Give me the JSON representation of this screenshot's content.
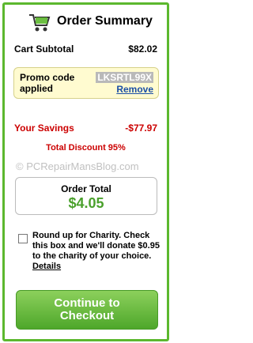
{
  "header": {
    "title": "Order Summary",
    "icon": "cart-icon"
  },
  "subtotal": {
    "label": "Cart Subtotal",
    "value": "$82.02"
  },
  "promo": {
    "label": "Promo code applied",
    "code": "LKSRTL99X",
    "remove_label": "Remove"
  },
  "savings": {
    "label": "Your Savings",
    "value": "-$77.97"
  },
  "discount": {
    "text": "Total Discount 95%"
  },
  "watermark": {
    "text": "© PCRepairMansBlog.com"
  },
  "order_total": {
    "label": "Order Total",
    "value": "$4.05"
  },
  "charity": {
    "text": "Round up for Charity. Check this box and we'll donate $0.95 to the charity of your choice.",
    "details_label": "Details",
    "checked": false
  },
  "checkout": {
    "line1": "Continue to",
    "line2": "Checkout"
  },
  "colors": {
    "accent_green": "#5cb82e",
    "savings_red": "#cc0000",
    "total_green": "#4aa02c",
    "link_blue": "#1b4fa6",
    "promo_bg": "#fffbd0"
  }
}
